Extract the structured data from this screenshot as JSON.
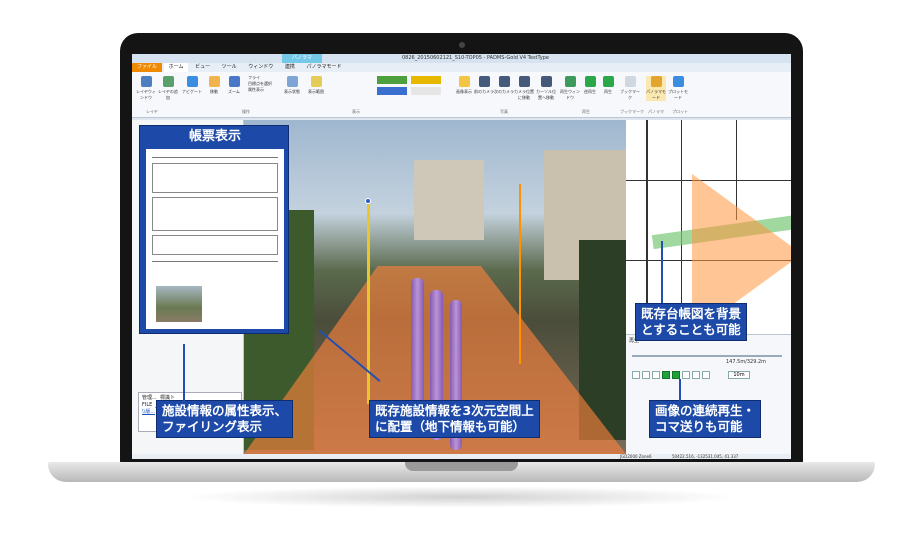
{
  "window": {
    "title": "0826_20150602121_S10-TOP05 - PADMS-Gold V4 TestType",
    "context_tab": "パノラマ",
    "tabs": [
      "ファイル",
      "ホーム",
      "ビュー",
      "ツール",
      "ウィンドウ",
      "連携",
      "パノラマモード"
    ]
  },
  "ribbon": {
    "buttons": [
      "レイヤウィンドウ",
      "レイヤの追加",
      "ナビゲート",
      "移動",
      "ズーム",
      "表示状態",
      "表示範囲",
      "画像表示",
      "前のカメラ",
      "次のカメラ",
      "カメラ位置に移動",
      "カーソル位置へ移動",
      "再生ウィンドウ",
      "逆再生",
      "再生",
      "ブックマーク",
      "パノラマモード",
      "プロットモード"
    ],
    "groups": [
      "レイヤ",
      "操作",
      "表示",
      "写真",
      "再生",
      "ブックマーク",
      "パノラマ",
      "プロット"
    ],
    "options": [
      "フライ",
      "目標点を選択",
      "属性表示"
    ]
  },
  "callouts": {
    "form_view": "帳票表示",
    "facility_attr_line1": "施設情報の属性表示、",
    "facility_attr_line2": "ファイリング表示",
    "existing_3d_line1": "既存施設情報を3次元空間上",
    "existing_3d_line2": "に配置（地下情報も可能）",
    "map_bg_line1": "既存台帳図を背景",
    "map_bg_line2": "とすることも可能",
    "playback_line1": "画像の連続再生・",
    "playback_line2": "コマ送りも可能"
  },
  "attribute_panel": {
    "row1_key": "管理...",
    "row1_val": "標識ト",
    "row2_key": "FILE",
    "row2_val": "D:\\\\スコア\\\\道路管理\\\\PMS\\\\ドイツ\\\\版..."
  },
  "playback": {
    "header": "再生",
    "distance": "147.5m/329.2m",
    "step": "10m"
  },
  "statusbar": {
    "coord_system": "JGD2000 Zone6",
    "coordinates": "50422.516, -132531.045, 41.337"
  },
  "colors": {
    "callout_blue": "#1d4aa8",
    "orange_tab": "#f08a00"
  }
}
